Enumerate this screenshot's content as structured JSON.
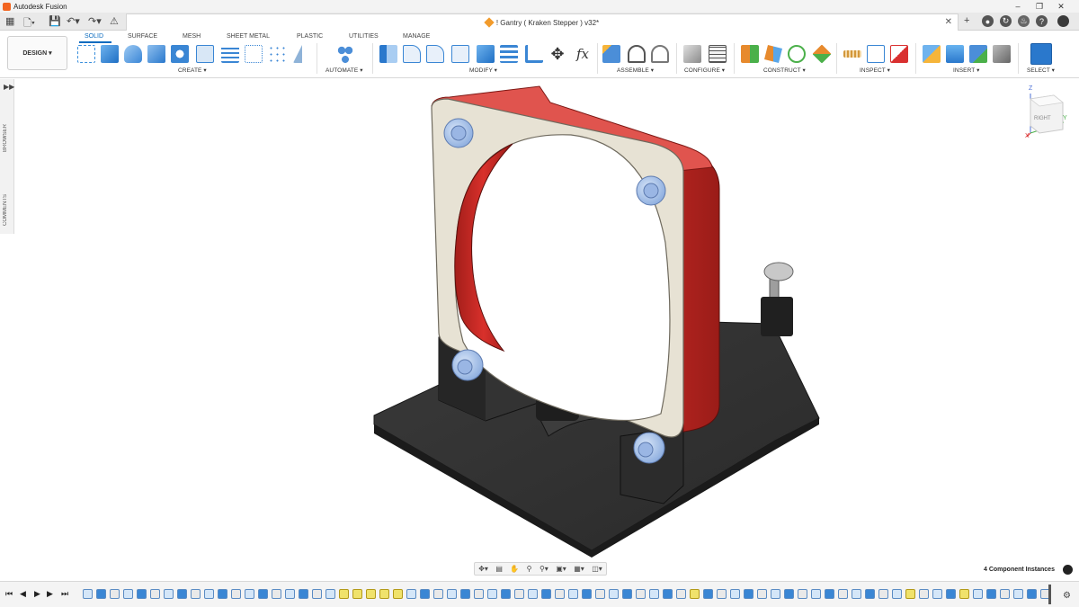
{
  "app": {
    "title": "Autodesk Fusion"
  },
  "document": {
    "tab_title": "! Gantry ( Kraken Stepper ) v32*"
  },
  "workspace": {
    "label": "DESIGN ▾"
  },
  "ribbon": {
    "tabs": [
      "SOLID",
      "SURFACE",
      "MESH",
      "SHEET METAL",
      "PLASTIC",
      "UTILITIES",
      "MANAGE"
    ],
    "groups": [
      {
        "label": "CREATE ▾"
      },
      {
        "label": "AUTOMATE ▾"
      },
      {
        "label": "MODIFY ▾"
      },
      {
        "label": "ASSEMBLE ▾"
      },
      {
        "label": "CONFIGURE ▾"
      },
      {
        "label": "CONSTRUCT ▾"
      },
      {
        "label": "INSPECT ▾"
      },
      {
        "label": "INSERT ▾"
      },
      {
        "label": "SELECT ▾"
      }
    ]
  },
  "left_panel": {
    "browser": "BROWSER",
    "comments": "COMMENTS"
  },
  "viewcube": {
    "face": "RIGHT",
    "axis_z": "Z",
    "axis_y": "Y",
    "axis_x": "X"
  },
  "status": {
    "instances": "4 Component Instances"
  },
  "colors": {
    "accent": "#0b6bbf",
    "model_red": "#d8302b",
    "model_tan": "#e6e1d3",
    "model_dark": "#2b2b2b",
    "insert_blue": "#a9c4ea"
  }
}
